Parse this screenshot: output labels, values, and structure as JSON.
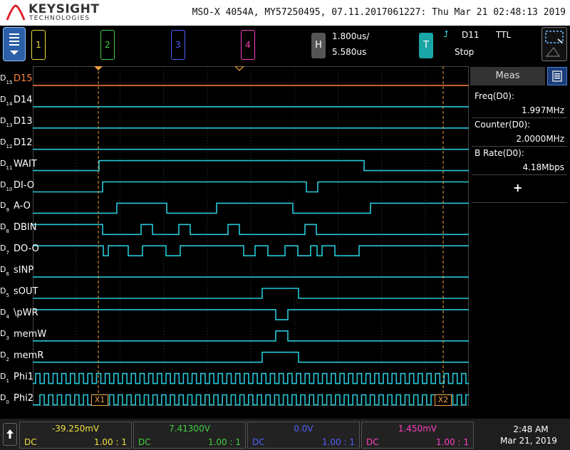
{
  "header": {
    "brand": "KEYSIGHT",
    "brand_sub": "TECHNOLOGIES",
    "title": "MSO-X 4054A, MY57250495, 07.11.2017061227: Thu Mar 21 02:48:13 2019"
  },
  "channels_top": [
    {
      "label": "1",
      "color": "#f0e040"
    },
    {
      "label": "2",
      "color": "#40d040"
    },
    {
      "label": "3",
      "color": "#5060ff"
    },
    {
      "label": "4",
      "color": "#ff40c0"
    }
  ],
  "horizontal": {
    "label": "H",
    "scale": "1.800us/",
    "delay": "5.580us"
  },
  "trigger": {
    "label": "T",
    "edge_symbol": "⮥",
    "source": "D11",
    "level": "TTL",
    "mode": "Stop"
  },
  "digital_channels": [
    {
      "num": "15",
      "name": "D15"
    },
    {
      "num": "14",
      "name": "D14"
    },
    {
      "num": "13",
      "name": "D13"
    },
    {
      "num": "12",
      "name": "D12"
    },
    {
      "num": "11",
      "name": "WAIT"
    },
    {
      "num": "10",
      "name": "DI-O"
    },
    {
      "num": "9",
      "name": "A-O"
    },
    {
      "num": "8",
      "name": "DBIN"
    },
    {
      "num": "7",
      "name": "DO-O"
    },
    {
      "num": "6",
      "name": "sINP"
    },
    {
      "num": "5",
      "name": "sOUT"
    },
    {
      "num": "4",
      "name": "\\pWR"
    },
    {
      "num": "3",
      "name": "memW"
    },
    {
      "num": "2",
      "name": "memR"
    },
    {
      "num": "1",
      "name": "Phi1"
    },
    {
      "num": "0",
      "name": "Phi2"
    }
  ],
  "cursors": {
    "x1": "X1",
    "x2": "X2"
  },
  "measurements": {
    "title": "Meas",
    "items": [
      {
        "name": "Freq(D0):",
        "value": "1.997MHz"
      },
      {
        "name": "Counter(D0):",
        "value": "2.0000MHz"
      },
      {
        "name": "B Rate(D0):",
        "value": "4.18Mbps"
      }
    ],
    "add_symbol": "+"
  },
  "channel_status": [
    {
      "value": "-39.250mV",
      "coupling": "DC",
      "probe": "1.00 : 1",
      "color": "#f0e040"
    },
    {
      "value": "7.41300V",
      "coupling": "DC",
      "probe": "1.00 : 1",
      "color": "#40d040"
    },
    {
      "value": "0.0V",
      "coupling": "DC",
      "probe": "1.00 : 1",
      "color": "#5060ff"
    },
    {
      "value": "1.450mV",
      "coupling": "DC",
      "probe": "1.00 : 1",
      "color": "#ff40c0"
    }
  ],
  "clock": {
    "time": "2:48 AM",
    "date": "Mar 21, 2019"
  }
}
